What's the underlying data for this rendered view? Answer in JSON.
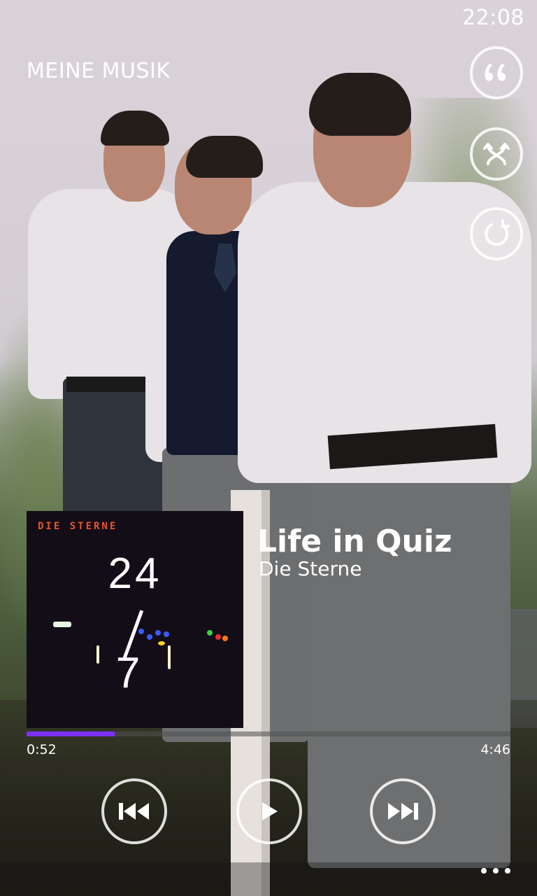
{
  "status": {
    "time": "22:08"
  },
  "header": {
    "section_title": "MEINE MUSIK"
  },
  "side_actions": [
    {
      "name": "lyrics",
      "icon": "quote-icon"
    },
    {
      "name": "shuffle",
      "icon": "shuffle-icon"
    },
    {
      "name": "repeat",
      "icon": "repeat-icon"
    }
  ],
  "now_playing": {
    "title": "Life in Quiz",
    "artist": "Die Sterne",
    "album_art": {
      "band_text": "DIE STERNE",
      "num_top": "24",
      "num_bottom": "7"
    }
  },
  "progress": {
    "elapsed": "0:52",
    "total": "4:46",
    "fraction": 0.182,
    "accent": "#7b2ff7"
  },
  "transport": [
    {
      "name": "previous",
      "icon": "previous-icon"
    },
    {
      "name": "play",
      "icon": "play-icon"
    },
    {
      "name": "next",
      "icon": "next-icon"
    }
  ],
  "appbar": {
    "more_icon": "more-dots-icon"
  }
}
